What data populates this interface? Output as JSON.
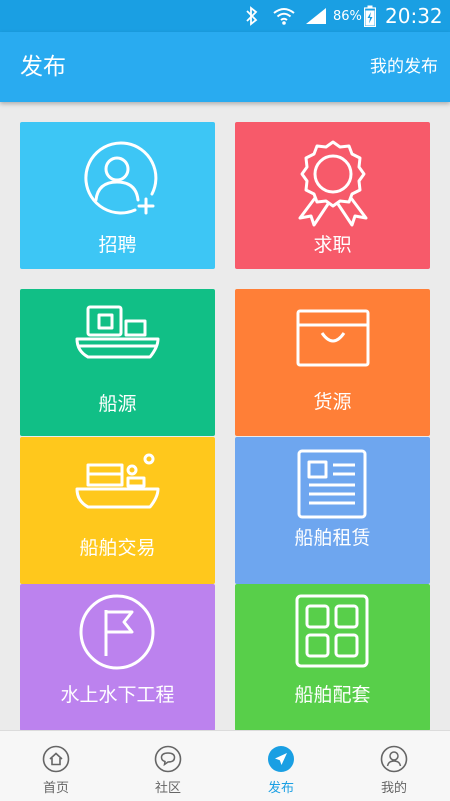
{
  "status_bar": {
    "battery": "86%",
    "time": "20:32"
  },
  "header": {
    "title": "发布",
    "action_label": "我的发布"
  },
  "tiles": [
    {
      "label": "招聘",
      "color": "#3dc6f5",
      "icon": "add-user-icon"
    },
    {
      "label": "求职",
      "color": "#f75a6a",
      "icon": "award-ribbon-icon"
    },
    {
      "label": "船源",
      "color": "#11bf86",
      "icon": "boat-icon"
    },
    {
      "label": "货源",
      "color": "#ff7f37",
      "icon": "cargo-box-icon"
    },
    {
      "label": "船舶交易",
      "color": "#ffc81c",
      "icon": "ship-cargo-icon"
    },
    {
      "label": "船舶租赁",
      "color": "#6ea6ef",
      "icon": "document-icon"
    },
    {
      "label": "水上水下工程",
      "color": "#bc82ee",
      "icon": "flag-icon"
    },
    {
      "label": "船舶配套",
      "color": "#58cf4a",
      "icon": "grid-icon"
    }
  ],
  "bottom_nav": [
    {
      "label": "首页",
      "icon": "home-icon",
      "active": false
    },
    {
      "label": "社区",
      "icon": "chat-icon",
      "active": false
    },
    {
      "label": "发布",
      "icon": "send-icon",
      "active": true
    },
    {
      "label": "我的",
      "icon": "user-icon",
      "active": false
    }
  ],
  "colors": {
    "accent": "#29abf0",
    "nav_active": "#1a9fe3"
  }
}
